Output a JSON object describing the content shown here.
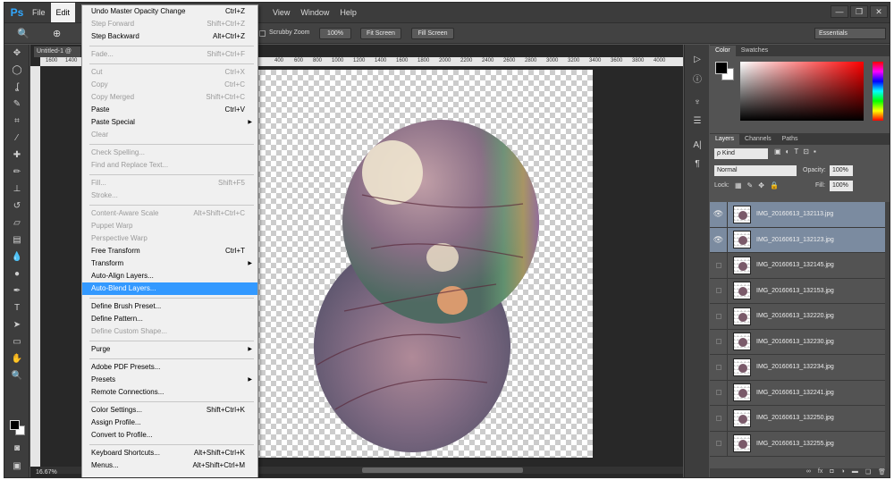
{
  "app": {
    "logo": "Ps"
  },
  "menubar": {
    "items": [
      "File",
      "Edit",
      "View",
      "Window",
      "Help"
    ]
  },
  "window_buttons": [
    "—",
    "❐",
    "✕"
  ],
  "options_bar": {
    "scrubby_zoom_label": "Scrubby Zoom",
    "zoom_percent_button": "100%",
    "fit_screen_button": "Fit Screen",
    "fill_screen_button": "Fill Screen",
    "workspace": "Essentials"
  },
  "document": {
    "tab_title": "Untitled-1 @",
    "ruler_left_labels": [
      "1600",
      "1400"
    ],
    "ruler_top_labels": [
      "400",
      "600",
      "800",
      "1000",
      "1200",
      "1400",
      "1600",
      "1800",
      "2000",
      "2200",
      "2400",
      "2600",
      "2800",
      "3000",
      "3200",
      "3400",
      "3600",
      "3800",
      "4000"
    ],
    "zoom_level": "16.67%"
  },
  "edit_menu": {
    "items": [
      {
        "label": "Undo Master Opacity Change",
        "shortcut": "Ctrl+Z",
        "disabled": false
      },
      {
        "label": "Step Forward",
        "shortcut": "Shift+Ctrl+Z",
        "disabled": true
      },
      {
        "label": "Step Backward",
        "shortcut": "Alt+Ctrl+Z",
        "disabled": false
      },
      {
        "sep": true
      },
      {
        "label": "Fade...",
        "shortcut": "Shift+Ctrl+F",
        "disabled": true
      },
      {
        "sep": true
      },
      {
        "label": "Cut",
        "shortcut": "Ctrl+X",
        "disabled": true
      },
      {
        "label": "Copy",
        "shortcut": "Ctrl+C",
        "disabled": true
      },
      {
        "label": "Copy Merged",
        "shortcut": "Shift+Ctrl+C",
        "disabled": true
      },
      {
        "label": "Paste",
        "shortcut": "Ctrl+V",
        "disabled": false
      },
      {
        "label": "Paste Special",
        "shortcut": "",
        "disabled": false,
        "submenu": true
      },
      {
        "label": "Clear",
        "shortcut": "",
        "disabled": true
      },
      {
        "sep": true
      },
      {
        "label": "Check Spelling...",
        "shortcut": "",
        "disabled": true
      },
      {
        "label": "Find and Replace Text...",
        "shortcut": "",
        "disabled": true
      },
      {
        "sep": true
      },
      {
        "label": "Fill...",
        "shortcut": "Shift+F5",
        "disabled": true
      },
      {
        "label": "Stroke...",
        "shortcut": "",
        "disabled": true
      },
      {
        "sep": true
      },
      {
        "label": "Content-Aware Scale",
        "shortcut": "Alt+Shift+Ctrl+C",
        "disabled": true
      },
      {
        "label": "Puppet Warp",
        "shortcut": "",
        "disabled": true
      },
      {
        "label": "Perspective Warp",
        "shortcut": "",
        "disabled": true
      },
      {
        "label": "Free Transform",
        "shortcut": "Ctrl+T",
        "disabled": false
      },
      {
        "label": "Transform",
        "shortcut": "",
        "disabled": false,
        "submenu": true
      },
      {
        "label": "Auto-Align Layers...",
        "shortcut": "",
        "disabled": false
      },
      {
        "label": "Auto-Blend Layers...",
        "shortcut": "",
        "disabled": false,
        "highlighted": true
      },
      {
        "sep": true
      },
      {
        "label": "Define Brush Preset...",
        "shortcut": "",
        "disabled": false
      },
      {
        "label": "Define Pattern...",
        "shortcut": "",
        "disabled": false
      },
      {
        "label": "Define Custom Shape...",
        "shortcut": "",
        "disabled": true
      },
      {
        "sep": true
      },
      {
        "label": "Purge",
        "shortcut": "",
        "disabled": false,
        "submenu": true
      },
      {
        "sep": true
      },
      {
        "label": "Adobe PDF Presets...",
        "shortcut": "",
        "disabled": false
      },
      {
        "label": "Presets",
        "shortcut": "",
        "disabled": false,
        "submenu": true
      },
      {
        "label": "Remote Connections...",
        "shortcut": "",
        "disabled": false
      },
      {
        "sep": true
      },
      {
        "label": "Color Settings...",
        "shortcut": "Shift+Ctrl+K",
        "disabled": false
      },
      {
        "label": "Assign Profile...",
        "shortcut": "",
        "disabled": false
      },
      {
        "label": "Convert to Profile...",
        "shortcut": "",
        "disabled": false
      },
      {
        "sep": true
      },
      {
        "label": "Keyboard Shortcuts...",
        "shortcut": "Alt+Shift+Ctrl+K",
        "disabled": false
      },
      {
        "label": "Menus...",
        "shortcut": "Alt+Shift+Ctrl+M",
        "disabled": false
      }
    ]
  },
  "color_panel": {
    "tabs": [
      "Color",
      "Swatches"
    ]
  },
  "layers_panel": {
    "tabs": [
      "Layers",
      "Channels",
      "Paths"
    ],
    "kind_filter": "ρ Kind",
    "blend_mode": "Normal",
    "opacity_label": "Opacity:",
    "opacity_value": "100%",
    "lock_label": "Lock:",
    "fill_label": "Fill:",
    "fill_value": "100%",
    "layers": [
      {
        "name": "IMG_20160613_132113.jpg",
        "visible": true,
        "selected": true
      },
      {
        "name": "IMG_20160613_132123.jpg",
        "visible": true,
        "selected": true
      },
      {
        "name": "IMG_20160613_132145.jpg",
        "visible": false,
        "selected": false
      },
      {
        "name": "IMG_20160613_132153.jpg",
        "visible": false,
        "selected": false
      },
      {
        "name": "IMG_20160613_132220.jpg",
        "visible": false,
        "selected": false
      },
      {
        "name": "IMG_20160613_132230.jpg",
        "visible": false,
        "selected": false
      },
      {
        "name": "IMG_20160613_132234.jpg",
        "visible": false,
        "selected": false
      },
      {
        "name": "IMG_20160613_132241.jpg",
        "visible": false,
        "selected": false
      },
      {
        "name": "IMG_20160613_132250.jpg",
        "visible": false,
        "selected": false
      },
      {
        "name": "IMG_20160613_132255.jpg",
        "visible": false,
        "selected": false
      }
    ]
  },
  "colors": {
    "highlight": "#3399ff",
    "selected_layer": "#7b8ba0",
    "ps_blue": "#31a8ff"
  }
}
